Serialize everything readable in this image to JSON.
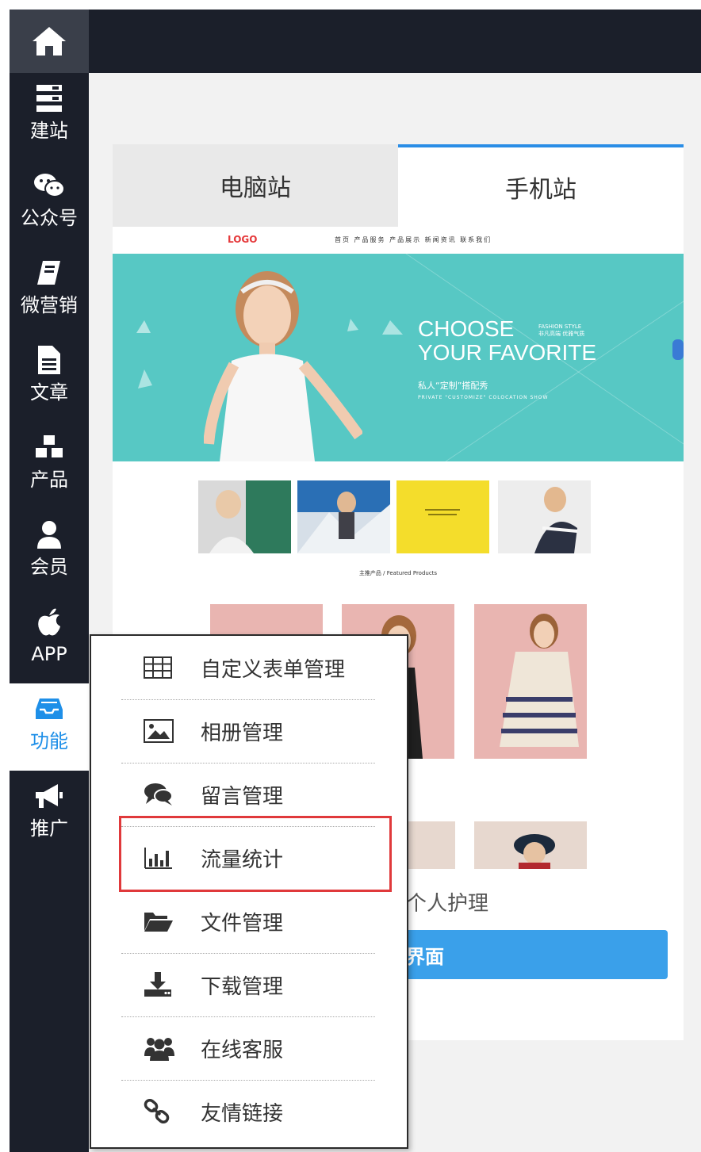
{
  "sidebar": {
    "items": [
      {
        "label": "建站",
        "icon": "server-icon"
      },
      {
        "label": "公众号",
        "icon": "wechat-icon"
      },
      {
        "label": "微营销",
        "icon": "book-icon"
      },
      {
        "label": "文章",
        "icon": "document-icon"
      },
      {
        "label": "产品",
        "icon": "cubes-icon"
      },
      {
        "label": "会员",
        "icon": "user-icon"
      },
      {
        "label": "APP",
        "icon": "apple-icon"
      },
      {
        "label": "功能",
        "icon": "inbox-icon",
        "active": true
      },
      {
        "label": "推广",
        "icon": "bullhorn-icon"
      }
    ]
  },
  "tabs": {
    "pc": "电脑站",
    "mobile": "手机站",
    "active": "mobile"
  },
  "preview": {
    "logo": "LOGO",
    "nav": "首页  产品服务  产品展示  新闻资讯  联系我们",
    "banner_line1": "CHOOSE",
    "banner_line2": "YOUR FAVORITE",
    "banner_fashion": "FASHION STYLE",
    "banner_fashion_cn": "非凡高端 优雅气质",
    "banner_cn": "私人“定制”搭配秀",
    "banner_en": "PRIVATE \"CUSTOMIZE\" COLOCATION SHOW",
    "featured": "主推产品 / Featured Products",
    "partial_text": "个人护理",
    "partial_button": "界面"
  },
  "dropdown": {
    "items": [
      {
        "label": "自定义表单管理",
        "icon": "table-icon"
      },
      {
        "label": "相册管理",
        "icon": "image-icon"
      },
      {
        "label": "留言管理",
        "icon": "comments-icon"
      },
      {
        "label": "流量统计",
        "icon": "bar-chart-icon",
        "highlighted": true
      },
      {
        "label": "文件管理",
        "icon": "folder-open-icon"
      },
      {
        "label": "下载管理",
        "icon": "download-icon"
      },
      {
        "label": "在线客服",
        "icon": "users-icon"
      },
      {
        "label": "友情链接",
        "icon": "link-icon"
      }
    ]
  },
  "colors": {
    "sidebar_bg": "#1b1f2a",
    "accent": "#1e8fe8",
    "highlight": "#e0393b",
    "banner_bg": "#57c8c4"
  }
}
